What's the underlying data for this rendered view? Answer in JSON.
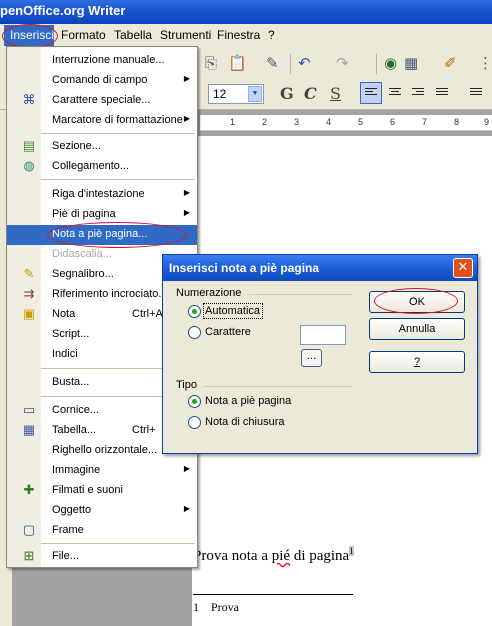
{
  "window": {
    "title": "penOffice.org Writer"
  },
  "menubar": {
    "items": [
      "Inserisci",
      "Formato",
      "Tabella",
      "Strumenti",
      "Finestra",
      "?"
    ]
  },
  "toolbar": {
    "font_size": "12",
    "bold": "G",
    "italic": "C",
    "underline": "S"
  },
  "ruler": {
    "numbers": [
      "1",
      "2",
      "3",
      "4",
      "5",
      "6",
      "7",
      "8",
      "9"
    ]
  },
  "insert_menu": {
    "items": [
      {
        "label": "Interruzione manuale...",
        "icon": "",
        "submenu": false
      },
      {
        "label": "Comando di campo",
        "icon": "",
        "submenu": true
      },
      {
        "label": "Carattere speciale...",
        "icon": "omega-symbol-icon",
        "submenu": false
      },
      {
        "label": "Marcatore di formattazione",
        "icon": "",
        "submenu": true
      },
      {
        "label": "Sezione...",
        "icon": "section-icon",
        "submenu": false
      },
      {
        "label": "Collegamento...",
        "icon": "hyperlink-globe-icon",
        "submenu": false
      },
      {
        "label": "Riga d'intestazione",
        "icon": "",
        "submenu": true
      },
      {
        "label": "Piè di pagina",
        "icon": "",
        "submenu": true
      },
      {
        "label": "Nota a piè pagina...",
        "icon": "",
        "submenu": false,
        "highlighted": true
      },
      {
        "label": "Didascalia...",
        "icon": "",
        "submenu": false,
        "disabled": true
      },
      {
        "label": "Segnalibro...",
        "icon": "bookmark-pin-icon",
        "submenu": false
      },
      {
        "label": "Riferimento incrociato...",
        "icon": "cross-reference-icon",
        "submenu": false
      },
      {
        "label": "Nota",
        "shortcut": "Ctrl+A",
        "icon": "note-icon",
        "submenu": false
      },
      {
        "label": "Script...",
        "icon": "",
        "submenu": false
      },
      {
        "label": "Indici",
        "icon": "",
        "submenu": true
      },
      {
        "label": "Busta...",
        "icon": "",
        "submenu": false
      },
      {
        "label": "Cornice...",
        "icon": "frame-icon",
        "submenu": false
      },
      {
        "label": "Tabella...",
        "shortcut": "Ctrl+",
        "icon": "table-grid-icon",
        "submenu": false
      },
      {
        "label": "Righello orizzontale...",
        "icon": "",
        "submenu": false
      },
      {
        "label": "Immagine",
        "icon": "",
        "submenu": true
      },
      {
        "label": "Filmati e suoni",
        "icon": "media-icon",
        "submenu": false
      },
      {
        "label": "Oggetto",
        "icon": "",
        "submenu": true
      },
      {
        "label": "Frame",
        "icon": "floating-frame-icon",
        "submenu": false
      },
      {
        "label": "File...",
        "icon": "insert-file-icon",
        "submenu": false
      }
    ]
  },
  "dialog": {
    "title": "Inserisci nota a piè pagina",
    "numbering_label": "Numerazione",
    "auto_label": "Automatica",
    "char_label": "Carattere",
    "char_value": "",
    "browse_label": "...",
    "type_label": "Tipo",
    "footnote_label": "Nota a piè pagina",
    "endnote_label": "Nota di chiusura",
    "ok_label": "OK",
    "cancel_label": "Annulla",
    "help_label": "?",
    "close_glyph": "✕"
  },
  "document": {
    "text_before": "Prova nota a ",
    "text_misspelled": "pié",
    "text_after": " di pagina",
    "footnote_anchor": "1",
    "footnote_number": "1",
    "footnote_text": "Prova"
  },
  "colors": {
    "highlight": "#316ac5",
    "annotation_red": "#d8132a",
    "titlebar_blue": "#1b55cf"
  }
}
